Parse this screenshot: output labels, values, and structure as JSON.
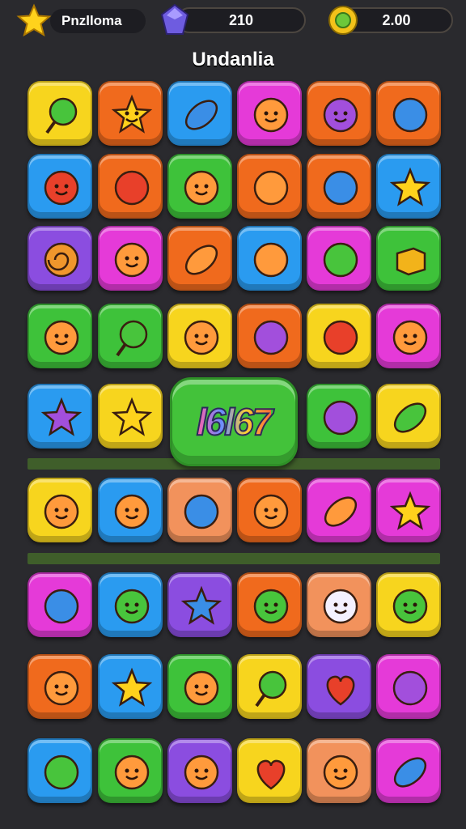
{
  "header": {
    "player_name": "Pnzlloma",
    "gems": "210",
    "coins": "2.00",
    "title": "Undanlia"
  },
  "banner": {
    "text": "l6l67"
  },
  "colors": {
    "yellow": "#f7d51e",
    "orange": "#f06a1d",
    "blue": "#2a9bf0",
    "magenta": "#e53ad8",
    "green": "#3ec23a",
    "purple": "#8b4de0",
    "peach": "#f2925c",
    "red": "#ef5a2a"
  },
  "board": {
    "rows": [
      [
        "yellow:green-lollipop-icon",
        "orange:star-face-icon",
        "blue:blue-leaf-icon",
        "magenta:smiley-face-icon",
        "orange:purple-creature-icon",
        "orange:blue-fruit-icon"
      ],
      [
        "blue:red-creature-icon",
        "orange:balloon-icon",
        "green:smiley-face-icon",
        "orange:orange-fruit-icon",
        "orange:blue-ball-icon",
        "blue:star-icon"
      ],
      [
        "purple:swirl-icon",
        "magenta:smiley-face-icon",
        "orange:leaf-icon",
        "blue:orange-ball-icon",
        "magenta:green-blob-icon",
        "green:cube-icon"
      ],
      [
        "green:smiley-face-icon",
        "green:green-lollipop-icon",
        "yellow:onion-face-icon",
        "orange:purple-fruit-icon",
        "yellow:strawberry-icon",
        "magenta:bear-face-icon"
      ],
      [
        "blue:purple-star-icon",
        "yellow:star-icon",
        "",
        "",
        "green:purple-fruit-icon",
        "yellow:green-leaf-icon"
      ],
      [
        "yellow:onion-face-icon",
        "blue:smiley-face-icon",
        "peach:blue-bubble-icon",
        "orange:smiley-face-icon",
        "magenta:leaf-icon",
        "magenta:star-icon"
      ],
      [
        "magenta:blue-bubble-icon",
        "blue:green-sun-icon",
        "purple:blue-star-icon",
        "orange:green-frog-icon",
        "peach:ghost-icon",
        "yellow:green-smiley-icon"
      ],
      [
        "orange:smiley-face-icon",
        "blue:star-icon",
        "green:sun-face-icon",
        "yellow:green-lollipop-icon",
        "purple:red-heart-icon",
        "magenta:purple-ball-icon"
      ],
      [
        "blue:green-ball-icon",
        "green:smiley-face-icon",
        "purple:orange-creature-icon",
        "yellow:red-heart-icon",
        "peach:bear-face-icon",
        "magenta:blue-leaf-icon"
      ]
    ]
  }
}
